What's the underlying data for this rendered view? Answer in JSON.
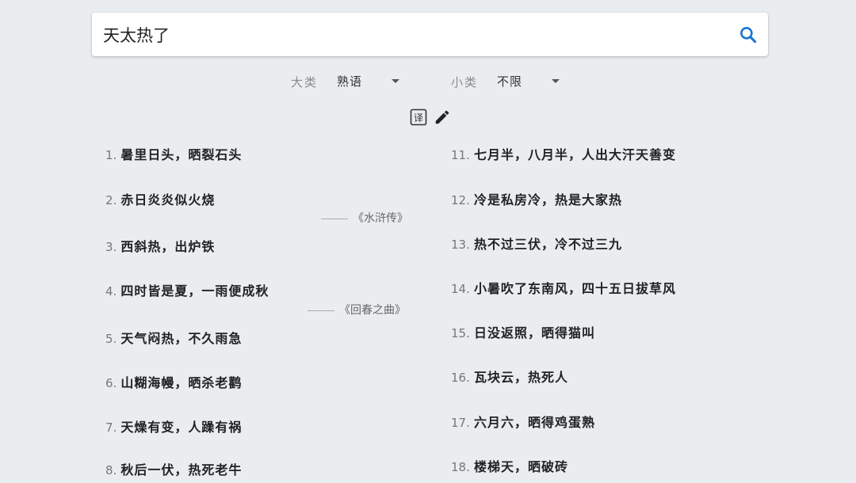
{
  "search": {
    "value": "天太热了"
  },
  "filters": {
    "major": {
      "label": "大类",
      "value": "熟语"
    },
    "minor": {
      "label": "小类",
      "value": "不限"
    }
  },
  "tools": {
    "translate_icon": "translate-icon",
    "edit_icon": "pencil-icon"
  },
  "colors": {
    "background": "#e9edf0",
    "search_icon": "#1976d2"
  },
  "left_items": [
    {
      "num": "1.",
      "text": "暑里日头，晒裂石头",
      "source": ""
    },
    {
      "num": "2.",
      "text": "赤日炎炎似火烧",
      "source": "《水浒传》"
    },
    {
      "num": "3.",
      "text": "西斜热，出炉铁",
      "source": ""
    },
    {
      "num": "4.",
      "text": "四时皆是夏，一雨便成秋",
      "source": "《回春之曲》"
    },
    {
      "num": "5.",
      "text": "天气闷热，不久雨急",
      "source": ""
    },
    {
      "num": "6.",
      "text": "山糊海幔，晒杀老鹳",
      "source": ""
    },
    {
      "num": "7.",
      "text": "天燥有变，人躁有祸",
      "source": ""
    },
    {
      "num": "8.",
      "text": "秋后一伏，热死老牛",
      "source": ""
    }
  ],
  "right_items": [
    {
      "num": "11.",
      "text": "七月半，八月半，人出大汗天善变"
    },
    {
      "num": "12.",
      "text": "冷是私房冷，热是大家热"
    },
    {
      "num": "13.",
      "text": "热不过三伏，冷不过三九"
    },
    {
      "num": "14.",
      "text": "小暑吹了东南风，四十五日拔草风"
    },
    {
      "num": "15.",
      "text": "日没返照，晒得猫叫"
    },
    {
      "num": "16.",
      "text": "瓦块云，热死人"
    },
    {
      "num": "17.",
      "text": "六月六，晒得鸡蛋熟"
    },
    {
      "num": "18.",
      "text": "楼梯天，晒破砖"
    }
  ]
}
